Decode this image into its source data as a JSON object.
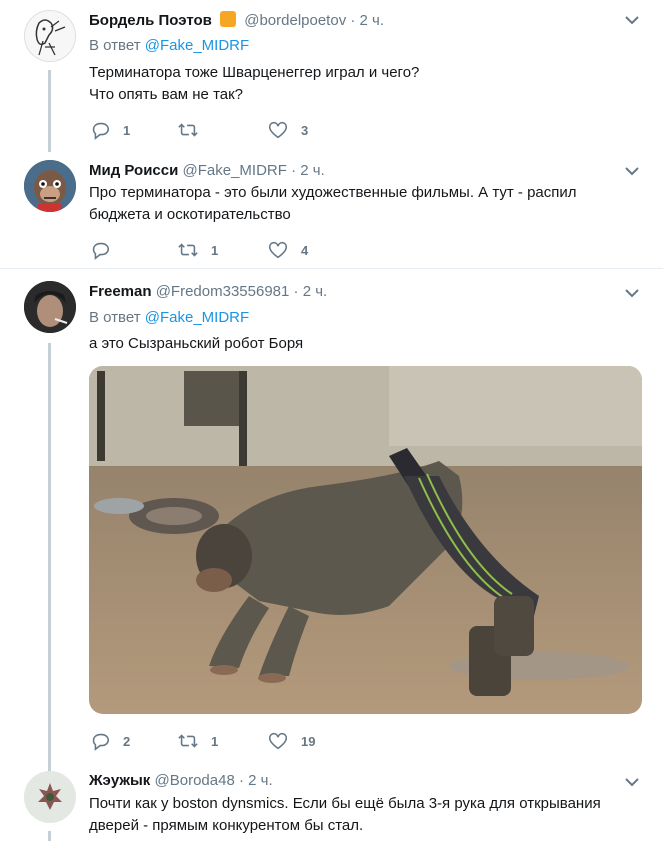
{
  "tweets": [
    {
      "name": "Бордель Поэтов",
      "handle": "@bordelpoetov",
      "dot": "·",
      "time": "2 ч.",
      "reply_prefix": "В ответ",
      "reply_to": "@Fake_MIDRF",
      "text_line1": "Терминатора тоже Шварценеггер играл и чего?",
      "text_line2": "Что опять вам не так?",
      "replies": "1",
      "retweets": "",
      "likes": "3"
    },
    {
      "name": "Мид Роисси",
      "handle": "@Fake_MIDRF",
      "dot": "·",
      "time": "2 ч.",
      "text_line1": "Про терминатора - это были художественные фильмы. А тут - распил",
      "text_line2": "бюджета и оскотирательство",
      "replies": "",
      "retweets": "1",
      "likes": "4"
    },
    {
      "name": "Freeman",
      "handle": "@Fredom33556981",
      "dot": "·",
      "time": "2 ч.",
      "reply_prefix": "В ответ",
      "reply_to": "@Fake_MIDRF",
      "text_line1": "а это Сызраньский робот Боря",
      "replies": "2",
      "retweets": "1",
      "likes": "19"
    },
    {
      "name": "Жэужык",
      "handle": "@Boroda48",
      "dot": "·",
      "time": "2 ч.",
      "text_line1": "Почти как у boston dynsmics. Если бы ещё была 3-я рука для открывания",
      "text_line2": "дверей - прямым конкурентом бы стал."
    }
  ],
  "icons": [
    "reply-icon",
    "retweet-icon",
    "like-icon",
    "chevron-down-icon",
    "verified-badge-icon"
  ],
  "colors": {
    "link": "#1b95e0",
    "muted": "#657786",
    "text": "#14171a",
    "line": "#c4cfd6",
    "divider": "#e6ecf0",
    "badge": "#f5a623"
  }
}
